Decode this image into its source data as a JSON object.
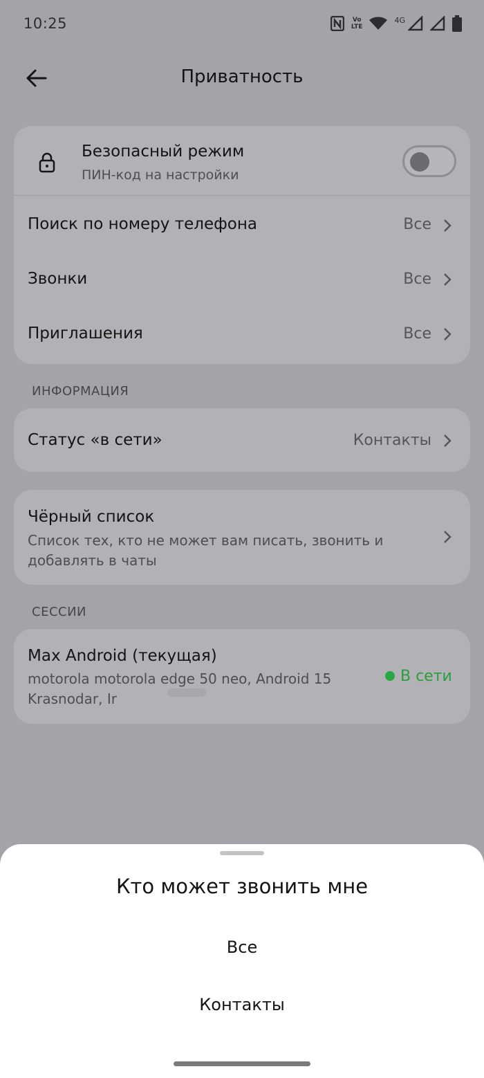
{
  "status": {
    "time": "10:25",
    "volte_top": "Vo",
    "volte_bottom": "LTE",
    "network": "4G"
  },
  "header": {
    "title": "Приватность"
  },
  "privacy": {
    "safe_mode": {
      "title": "Безопасный режим",
      "subtitle": "ПИН-код на настройки",
      "enabled": false
    },
    "rows": [
      {
        "label": "Поиск по номеру телефона",
        "value": "Все"
      },
      {
        "label": "Звонки",
        "value": "Все"
      },
      {
        "label": "Приглашения",
        "value": "Все"
      }
    ]
  },
  "info": {
    "section_label": "ИНФОРМАЦИЯ",
    "online_status": {
      "label": "Статус «в сети»",
      "value": "Контакты"
    }
  },
  "blacklist": {
    "title": "Чёрный список",
    "line1": "Список тех, кто не может вам писать, звонить и",
    "line2": "добавлять в чаты"
  },
  "sessions": {
    "section_label": "СЕССИИ",
    "current": {
      "title": "Max Android (текущая)",
      "device": "motorola motorola edge 50 neo, Android 15",
      "location": "Krasnodar, Ir",
      "status": "В сети"
    }
  },
  "sheet": {
    "title": "Кто может звонить мне",
    "options": [
      "Все",
      "Контакты"
    ]
  },
  "colors": {
    "online": "#2a9d3c",
    "overlay_bg": "#a4a3a8",
    "card_bg": "#b2b1b5"
  }
}
